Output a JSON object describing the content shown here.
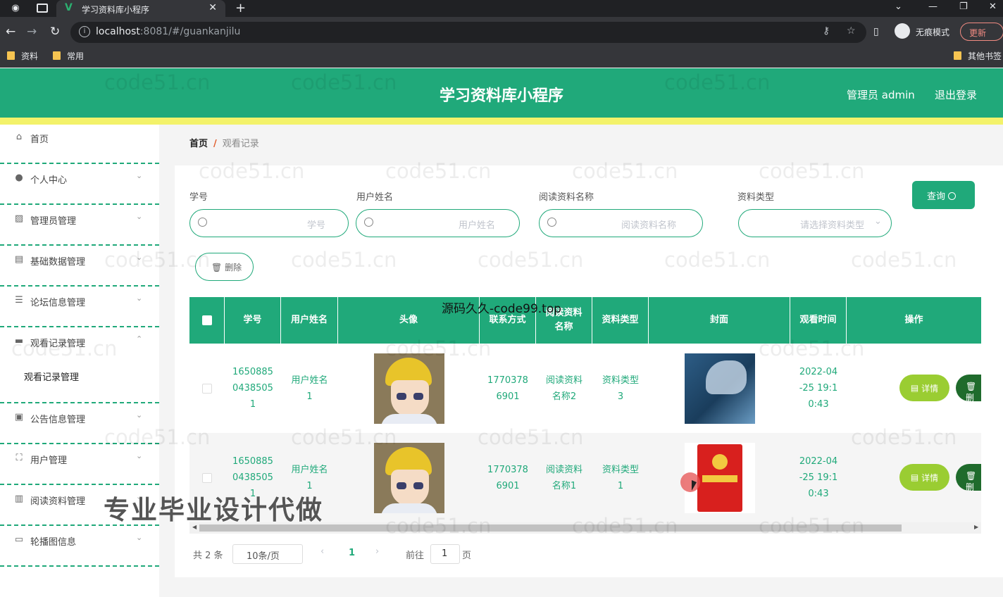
{
  "browser": {
    "tab_title": "学习资料库小程序",
    "url_host": "localhost",
    "url_rest": ":8081/#/guankanjilu",
    "incognito_label": "无痕模式",
    "update_label": "更新",
    "bookmarks": [
      "资料",
      "常用",
      "其他书签"
    ]
  },
  "header": {
    "title": "学习资料库小程序",
    "admin": "管理员 admin",
    "logout": "退出登录"
  },
  "sidebar": {
    "items": [
      {
        "label": "首页",
        "icon": "home-icon"
      },
      {
        "label": "个人中心",
        "icon": "user-icon"
      },
      {
        "label": "管理员管理",
        "icon": "chart-icon"
      },
      {
        "label": "基础数据管理",
        "icon": "chat-icon"
      },
      {
        "label": "论坛信息管理",
        "icon": "sliders-icon"
      },
      {
        "label": "观看记录管理",
        "icon": "stack-icon"
      },
      {
        "label": "公告信息管理",
        "icon": "clipboard-icon"
      },
      {
        "label": "用户管理",
        "icon": "frame-icon"
      },
      {
        "label": "阅读资料管理",
        "icon": "document-icon"
      },
      {
        "label": "轮播图信息",
        "icon": "monitor-icon"
      }
    ],
    "submenu": "观看记录管理"
  },
  "breadcrumb": {
    "home": "首页",
    "sep": "/",
    "current": "观看记录"
  },
  "filters": [
    {
      "label": "学号",
      "placeholder": "学号"
    },
    {
      "label": "用户姓名",
      "placeholder": "用户姓名"
    },
    {
      "label": "阅读资料名称",
      "placeholder": "阅读资料名称"
    },
    {
      "label": "资料类型",
      "placeholder": "请选择资料类型"
    }
  ],
  "query_label": "查询",
  "delete_label": "删除",
  "table": {
    "columns": [
      "学号",
      "用户姓名",
      "头像",
      "联系方式",
      "阅读资料名称",
      "资料类型",
      "封面",
      "观看时间",
      "操作"
    ],
    "rows": [
      {
        "id": "16508850438505 1",
        "name": "用户姓名 1",
        "phone": "1770378 6901",
        "material": "阅读资料 名称2",
        "type": "资料类型 3",
        "time": "2022-04 -25 19:1 0:43"
      },
      {
        "id": "16508850438505 1",
        "name": "用户姓名 1",
        "phone": "1770378 6901",
        "material": "阅读资料 名称1",
        "type": "资料类型 1",
        "time": "2022-04 -25 19:1 0:43"
      }
    ],
    "detail_label": "详情",
    "delete_label": "删"
  },
  "pagination": {
    "total": "共 2 条",
    "page_size": "10条/页",
    "current_page": "1",
    "goto": "前往",
    "goto_value": "1",
    "page_unit": "页"
  },
  "overlays": {
    "watermark": "code51.cn",
    "source_text": "源码久久-code99.top",
    "promo_text": "专业毕业设计代做"
  },
  "colors": {
    "primary": "#20a97a",
    "stripe": "#f3f26a",
    "detail": "#9acd32",
    "delete": "#1f6b2c"
  }
}
